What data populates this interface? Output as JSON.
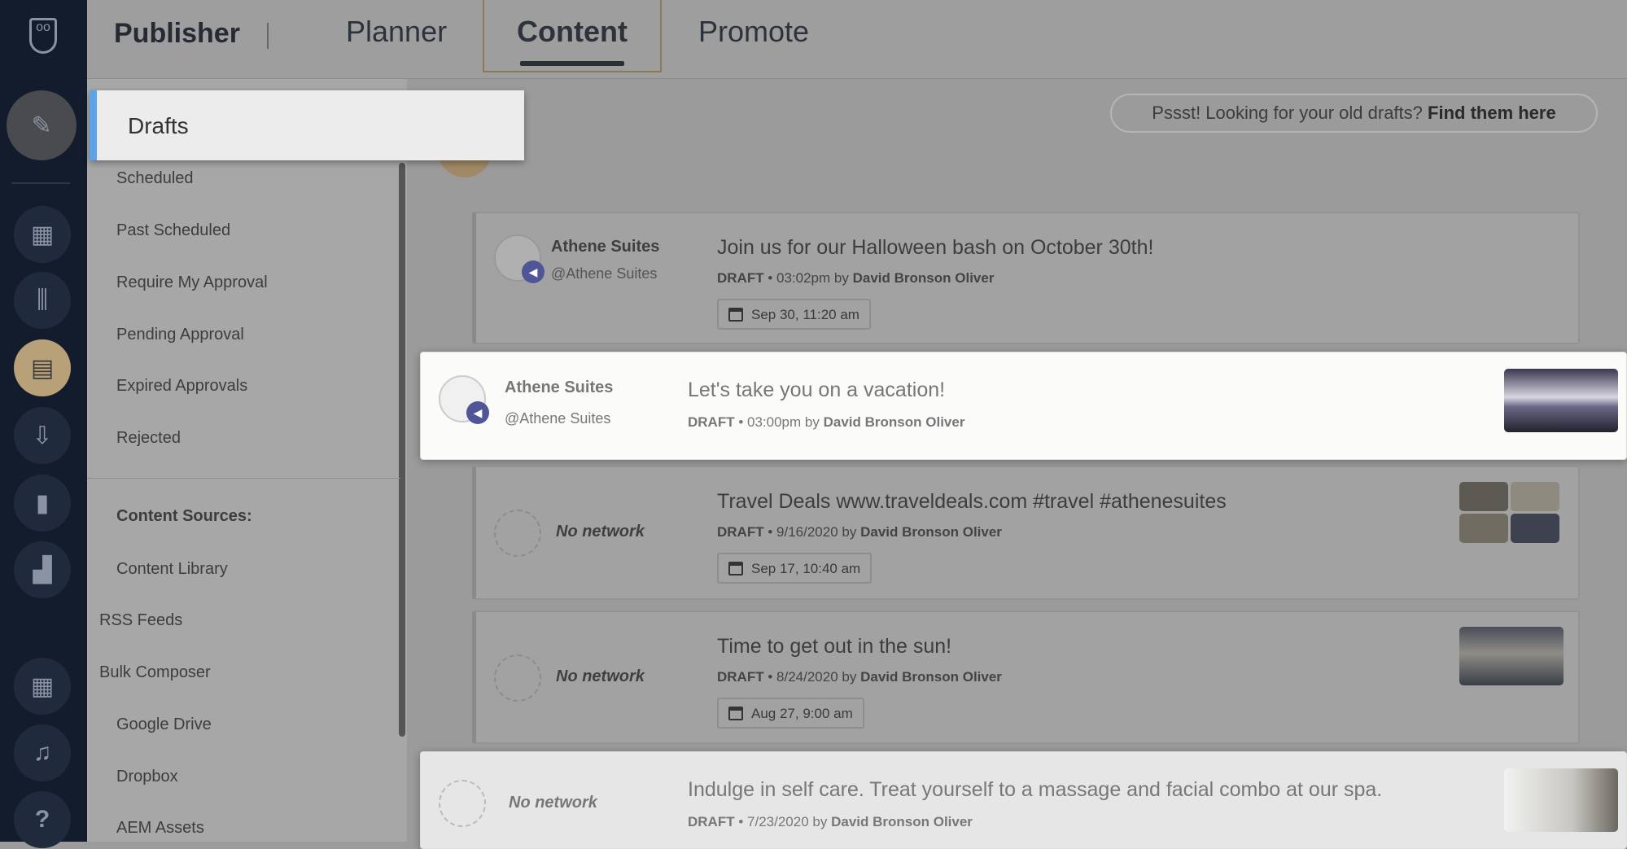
{
  "header": {
    "app": "Publisher",
    "tabs": [
      {
        "label": "Planner"
      },
      {
        "label": "Content",
        "active": true
      },
      {
        "label": "Promote"
      }
    ]
  },
  "rail": {
    "icons": [
      "owl-logo",
      "compose-icon",
      "dashboard-icon",
      "streams-icon",
      "calendar-icon",
      "inbox-icon",
      "clipboard-icon",
      "analytics-icon",
      "apps-icon",
      "bell-icon",
      "help-icon"
    ],
    "active_color": "#b8a078"
  },
  "sidebar": {
    "selected": "Drafts",
    "items": [
      "Scheduled",
      "Past Scheduled",
      "Require My Approval",
      "Pending Approval",
      "Expired Approvals",
      "Rejected"
    ],
    "sources_heading": "Content Sources:",
    "sources": [
      "Content Library",
      "RSS Feeds",
      "Bulk Composer",
      "Google Drive",
      "Dropbox",
      "AEM Assets"
    ]
  },
  "notice": {
    "text": "Pssst! Looking for your old drafts?",
    "link": "Find them here"
  },
  "posts": [
    {
      "name": "Athene Suites",
      "handle": "@Athene Suites",
      "message": "Join us for our Halloween bash on October 30th!",
      "status": "DRAFT",
      "time": "03:02pm",
      "by": "by",
      "author": "David Bronson Oliver",
      "date": "Sep 30, 11:20 am"
    },
    {
      "name": "Athene Suites",
      "handle": "@Athene Suites",
      "message": "Let's take you on a vacation!",
      "status": "DRAFT",
      "time": "03:00pm",
      "by": "by",
      "author": "David Bronson Oliver"
    },
    {
      "name": "No network",
      "message": "Travel Deals www.traveldeals.com #travel #athenesuites",
      "status": "DRAFT",
      "time": "9/16/2020",
      "by": "by",
      "author": "David Bronson Oliver",
      "date": "Sep 17, 10:40 am"
    },
    {
      "name": "No network",
      "message": "Time to get out in the sun!",
      "status": "DRAFT",
      "time": "8/24/2020",
      "by": "by",
      "author": "David Bronson Oliver",
      "date": "Aug 27, 9:00 am"
    },
    {
      "name": "No network",
      "message": "Indulge in self care. Treat yourself to a massage and facial combo at our spa.",
      "status": "DRAFT",
      "time": "7/23/2020",
      "by": "by",
      "author": "David Bronson Oliver"
    }
  ]
}
